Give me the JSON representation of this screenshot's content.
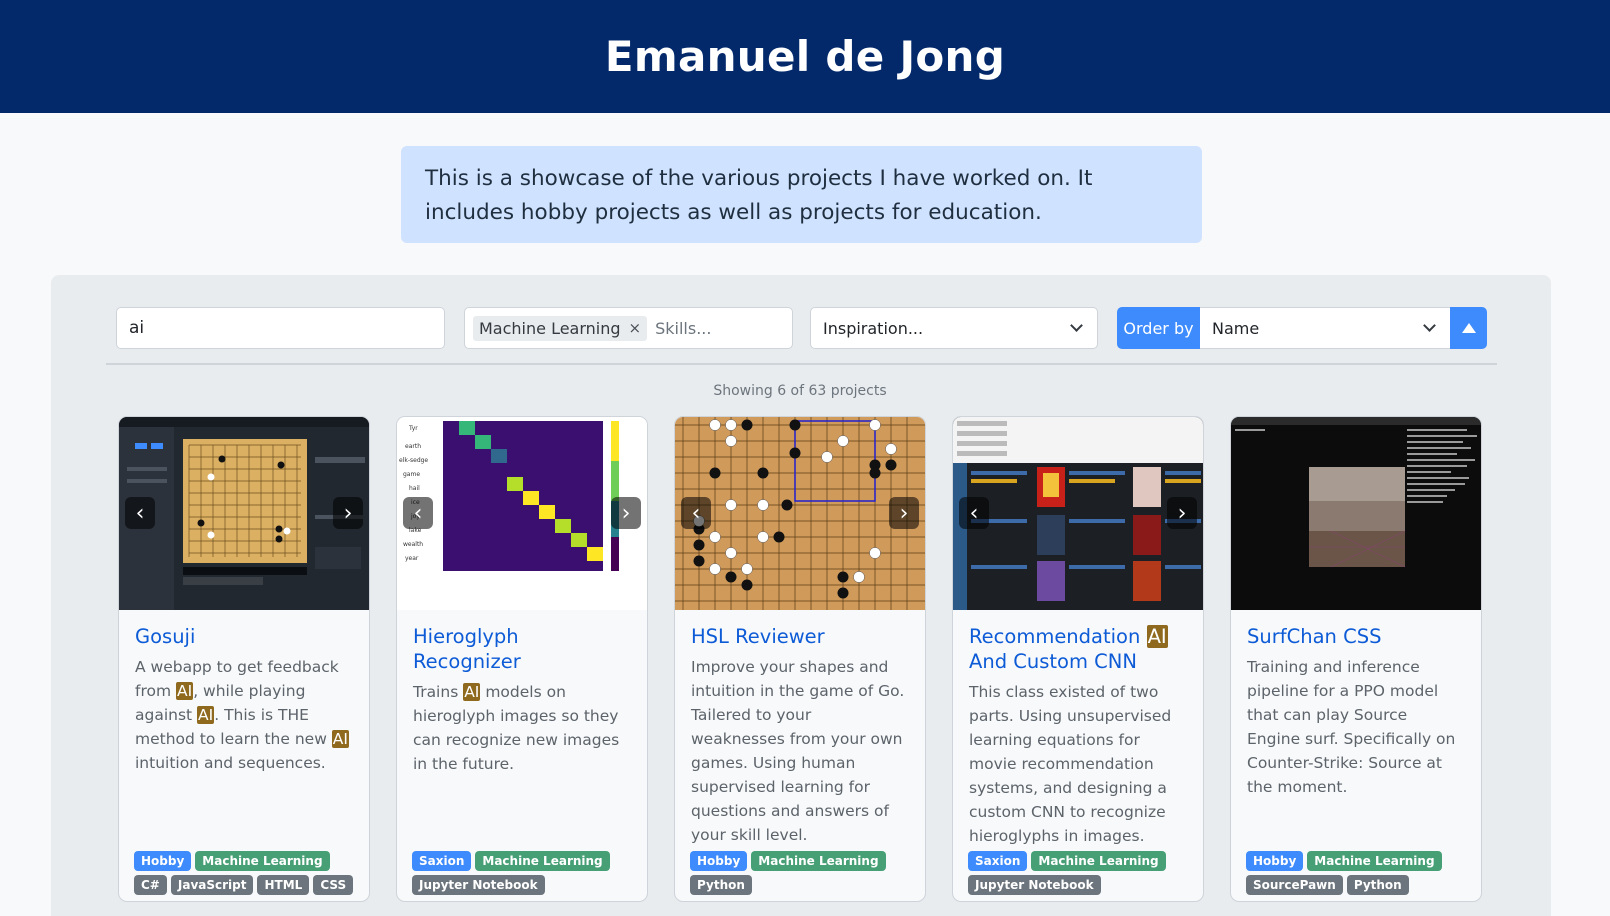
{
  "header": {
    "title": "Emanuel de Jong"
  },
  "intro": {
    "text": "This is a showcase of the various projects I have worked on. It includes hobby projects as well as projects for education."
  },
  "filters": {
    "search_value": "ai",
    "skills_chip": "Machine Learning",
    "skills_remove": "×",
    "skills_placeholder": "Skills...",
    "inspiration_placeholder": "Inspiration...",
    "order_by_label": "Order by",
    "order_by_value": "Name"
  },
  "results": {
    "count_text": "Showing 6 of 63 projects"
  },
  "colors": {
    "header": "#03296b",
    "accent": "#3d8bfd",
    "link": "#0d5bd7",
    "highlight": "#8f6a1e",
    "tag_hobby": "#3d8bfd",
    "tag_ml": "#479f76",
    "tag_lang": "#6c757d"
  },
  "projects": [
    {
      "title": "Gosuji",
      "desc": [
        {
          "t": "A webapp to get feedback from "
        },
        {
          "t": "AI",
          "hl": true
        },
        {
          "t": ", while playing against "
        },
        {
          "t": "AI",
          "hl": true
        },
        {
          "t": ". This is THE method to learn the new "
        },
        {
          "t": "AI",
          "hl": true
        },
        {
          "t": " intuition and sequences."
        }
      ],
      "tags": [
        {
          "label": "Hobby",
          "kind": "blue"
        },
        {
          "label": "Machine Learning",
          "kind": "green"
        },
        {
          "label": "C#",
          "kind": "gray"
        },
        {
          "label": "JavaScript",
          "kind": "gray"
        },
        {
          "label": "HTML",
          "kind": "gray"
        },
        {
          "label": "CSS",
          "kind": "gray"
        }
      ]
    },
    {
      "title": "Hieroglyph Recognizer",
      "desc": [
        {
          "t": "Trains "
        },
        {
          "t": "AI",
          "hl": true
        },
        {
          "t": " models on hieroglyph images so they can recognize new images in the future."
        }
      ],
      "tags": [
        {
          "label": "Saxion",
          "kind": "blue"
        },
        {
          "label": "Machine Learning",
          "kind": "green"
        },
        {
          "label": "Jupyter Notebook",
          "kind": "gray"
        }
      ]
    },
    {
      "title": "HSL Reviewer",
      "desc": [
        {
          "t": "Improve your shapes and intuition in the game of Go. Tailered to your weaknesses from your own games. Using human supervised learning for questions and answers of your skill level."
        }
      ],
      "tags": [
        {
          "label": "Hobby",
          "kind": "blue"
        },
        {
          "label": "Machine Learning",
          "kind": "green"
        },
        {
          "label": "Python",
          "kind": "gray"
        }
      ]
    },
    {
      "title_parts": [
        {
          "t": "Recommendation "
        },
        {
          "t": "AI",
          "hl": true
        },
        {
          "t": " And Custom CNN"
        }
      ],
      "desc": [
        {
          "t": "This class existed of two parts. Using unsupervised learning equations for movie recommendation systems, and designing a custom CNN to recognize hieroglyphs in images."
        }
      ],
      "tags": [
        {
          "label": "Saxion",
          "kind": "blue"
        },
        {
          "label": "Machine Learning",
          "kind": "green"
        },
        {
          "label": "Jupyter Notebook",
          "kind": "gray"
        }
      ]
    },
    {
      "title": "SurfChan CSS",
      "desc": [
        {
          "t": "Training and inference pipeline for a PPO model that can play Source Engine surf. Specifically on Counter-Strike: Source at the moment."
        }
      ],
      "tags": [
        {
          "label": "Hobby",
          "kind": "blue"
        },
        {
          "label": "Machine Learning",
          "kind": "green"
        },
        {
          "label": "SourcePawn",
          "kind": "gray"
        },
        {
          "label": "Python",
          "kind": "gray"
        }
      ]
    }
  ]
}
